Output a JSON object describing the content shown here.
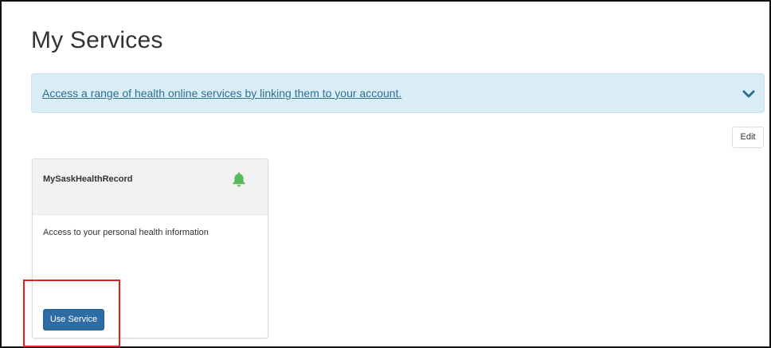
{
  "page": {
    "title": "My Services"
  },
  "banner": {
    "link_text": "Access a range of health online services by linking them to your account.",
    "expand_icon": "chevron-down-icon"
  },
  "toolbar": {
    "edit_label": "Edit"
  },
  "services": [
    {
      "name": "MySaskHealthRecord",
      "icon": "bell-icon",
      "icon_color": "#5cb85c",
      "description": "Access to your personal health information",
      "action_label": "Use Service"
    }
  ],
  "colors": {
    "banner_bg": "#d9edf7",
    "banner_link": "#31708f",
    "primary_button": "#2e6da4",
    "highlight": "#e02020"
  }
}
